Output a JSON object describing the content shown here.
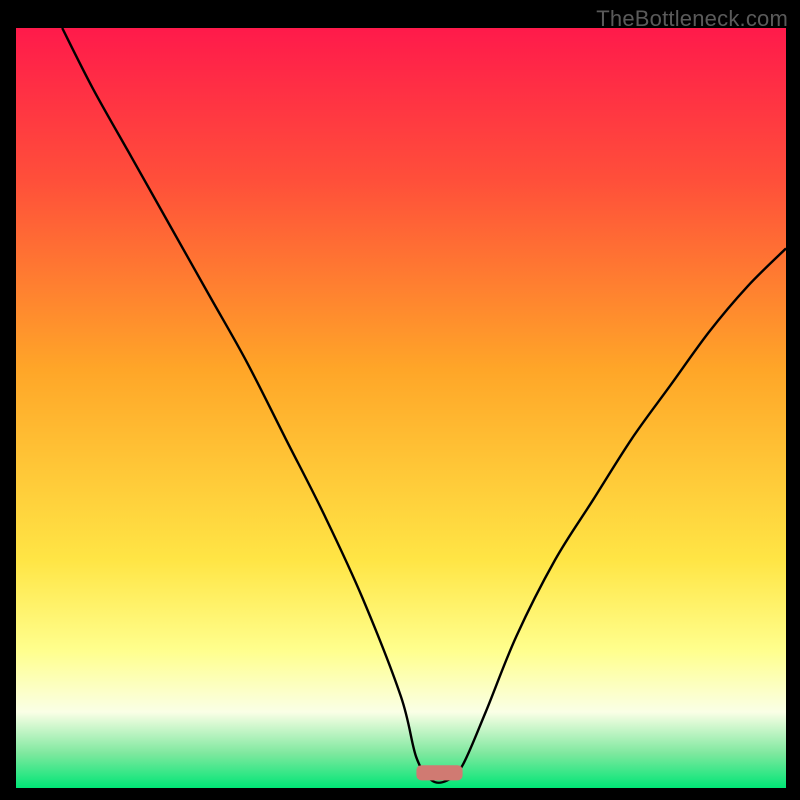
{
  "watermark": "TheBottleneck.com",
  "chart_data": {
    "type": "line",
    "title": "",
    "xlabel": "",
    "ylabel": "",
    "x_range": [
      0,
      100
    ],
    "y_range": [
      0,
      100
    ],
    "legend": false,
    "grid": false,
    "background_gradient": {
      "stops": [
        {
          "pos": 0.0,
          "color": "#ff1a4b"
        },
        {
          "pos": 0.2,
          "color": "#ff4f3a"
        },
        {
          "pos": 0.45,
          "color": "#ffa628"
        },
        {
          "pos": 0.7,
          "color": "#ffe545"
        },
        {
          "pos": 0.82,
          "color": "#ffff8e"
        },
        {
          "pos": 0.9,
          "color": "#faffe6"
        },
        {
          "pos": 0.955,
          "color": "#7de89e"
        },
        {
          "pos": 1.0,
          "color": "#00e676"
        }
      ]
    },
    "marker": {
      "x": 55,
      "y": 2,
      "width": 6,
      "height": 2,
      "color": "#d07a72"
    },
    "series": [
      {
        "name": "curve",
        "stroke": "#000000",
        "points": [
          {
            "x": 6,
            "y": 100
          },
          {
            "x": 10,
            "y": 92
          },
          {
            "x": 15,
            "y": 83
          },
          {
            "x": 20,
            "y": 74
          },
          {
            "x": 25,
            "y": 65
          },
          {
            "x": 30,
            "y": 56
          },
          {
            "x": 35,
            "y": 46
          },
          {
            "x": 40,
            "y": 36
          },
          {
            "x": 45,
            "y": 25
          },
          {
            "x": 50,
            "y": 12
          },
          {
            "x": 52,
            "y": 4
          },
          {
            "x": 54,
            "y": 1
          },
          {
            "x": 56,
            "y": 1
          },
          {
            "x": 58,
            "y": 3
          },
          {
            "x": 61,
            "y": 10
          },
          {
            "x": 65,
            "y": 20
          },
          {
            "x": 70,
            "y": 30
          },
          {
            "x": 75,
            "y": 38
          },
          {
            "x": 80,
            "y": 46
          },
          {
            "x": 85,
            "y": 53
          },
          {
            "x": 90,
            "y": 60
          },
          {
            "x": 95,
            "y": 66
          },
          {
            "x": 100,
            "y": 71
          }
        ]
      }
    ]
  }
}
